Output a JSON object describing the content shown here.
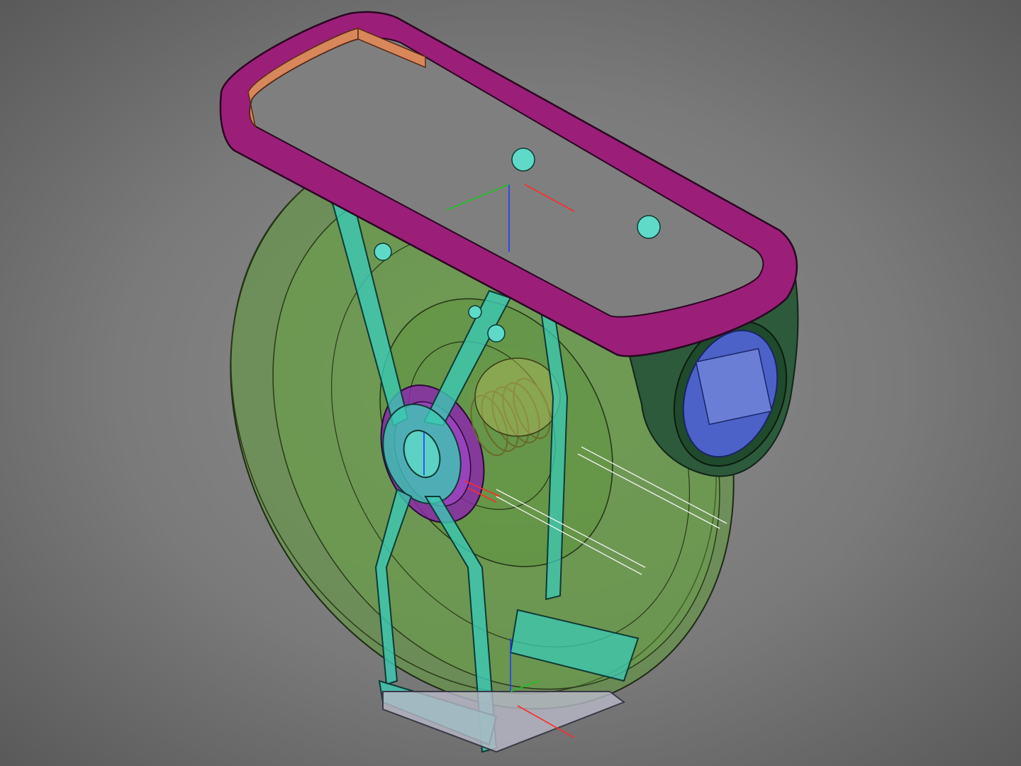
{
  "viewport": {
    "kind": "3d-cad-view",
    "background_color": "#7f7f7f",
    "display_mode": "transparent-shaded-with-edges"
  },
  "model": {
    "parts": [
      {
        "id": "top-frame",
        "color": "#9b1f78"
      },
      {
        "id": "top-frame-inner-face",
        "color": "#d8875a"
      },
      {
        "id": "reel-disc",
        "color": "#5f9a3a"
      },
      {
        "id": "stand-legs",
        "color": "#3cc9b4"
      },
      {
        "id": "side-housing",
        "color": "#2c5a3a"
      },
      {
        "id": "sensor-window",
        "color": "#4c62c8"
      },
      {
        "id": "hub-ring",
        "color": "#8a2aa8"
      },
      {
        "id": "spring-coil",
        "color": "#b4b85a"
      },
      {
        "id": "base-plate",
        "color": "#b9b9c8"
      }
    ],
    "axis_colors": {
      "x": "#ff2a2a",
      "y": "#21c021",
      "z": "#1e3cff"
    }
  }
}
